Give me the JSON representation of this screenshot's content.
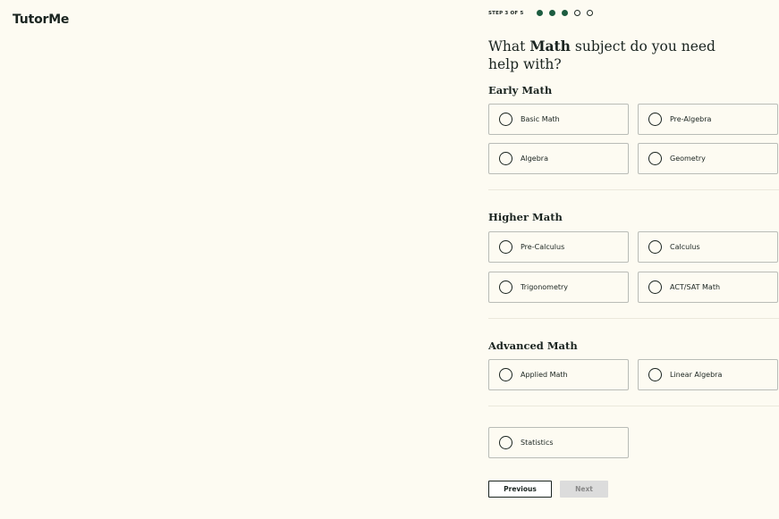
{
  "brand": {
    "logo": "TutorMe"
  },
  "progress": {
    "label": "STEP 3 OF 5",
    "current_step": 3,
    "total_steps": 5,
    "filled_color": "#1d5c40"
  },
  "question": {
    "pre": "What ",
    "highlight": "Math",
    "post": " subject do you need help with?"
  },
  "sections": {
    "early": {
      "title": "Early Math",
      "options": [
        "Basic Math",
        "Pre-Algebra",
        "Algebra",
        "Geometry"
      ]
    },
    "higher": {
      "title": "Higher Math",
      "options": [
        "Pre-Calculus",
        "Calculus",
        "Trigonometry",
        "ACT/SAT Math"
      ]
    },
    "advanced": {
      "title": "Advanced Math",
      "options": [
        "Applied Math",
        "Linear Algebra"
      ]
    },
    "other": {
      "options": [
        "Statistics"
      ]
    }
  },
  "buttons": {
    "previous": "Previous",
    "next": "Next"
  },
  "colors": {
    "background": "#fdfbf2",
    "accent": "#1d5c40",
    "next_disabled": "#dcdcdc"
  }
}
